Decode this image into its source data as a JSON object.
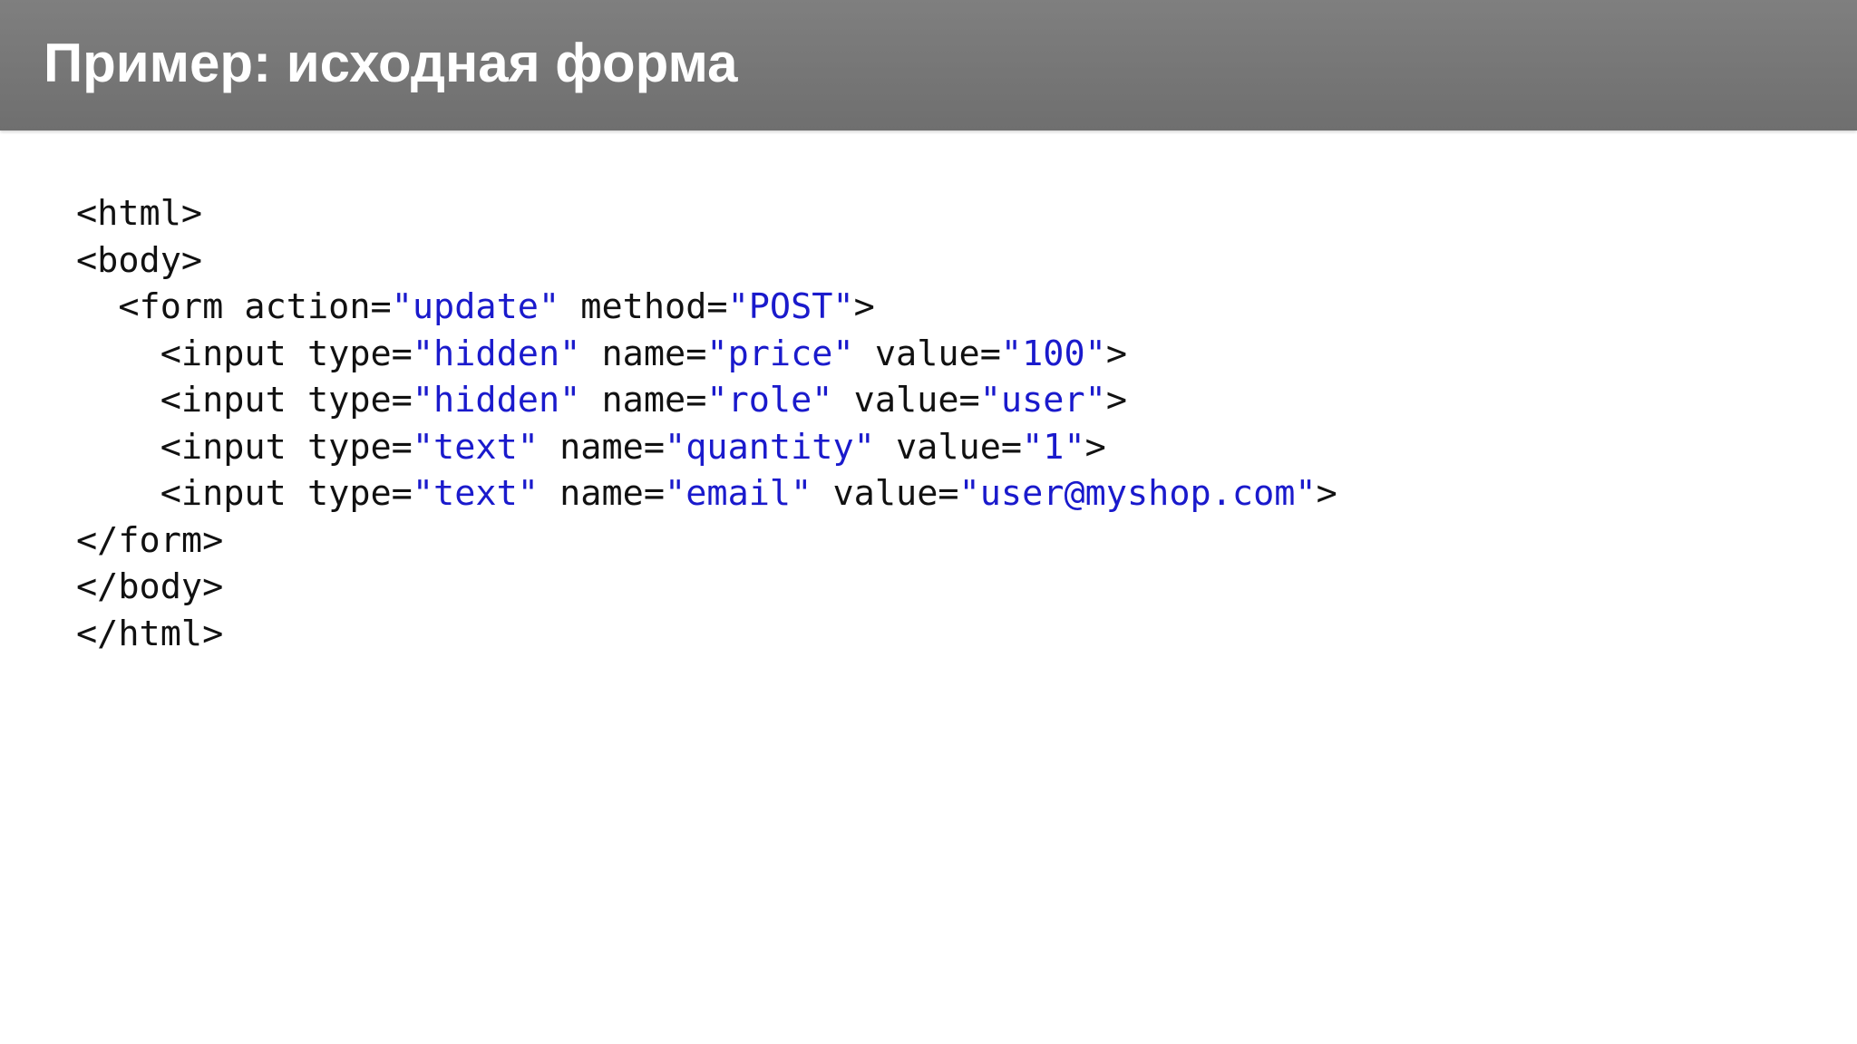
{
  "slide": {
    "title": "Пример: исходная форма"
  },
  "code": {
    "lines": [
      {
        "indent": 0,
        "tokens": [
          {
            "t": "<html>",
            "k": "plain"
          }
        ]
      },
      {
        "indent": 0,
        "tokens": [
          {
            "t": "<body>",
            "k": "plain"
          }
        ]
      },
      {
        "indent": 2,
        "tokens": [
          {
            "t": "<form action=",
            "k": "plain"
          },
          {
            "t": "\"update\"",
            "k": "str"
          },
          {
            "t": " method=",
            "k": "plain"
          },
          {
            "t": "\"POST\"",
            "k": "str"
          },
          {
            "t": ">",
            "k": "plain"
          }
        ]
      },
      {
        "indent": 4,
        "tokens": [
          {
            "t": "<input type=",
            "k": "plain"
          },
          {
            "t": "\"hidden\"",
            "k": "str"
          },
          {
            "t": " name=",
            "k": "plain"
          },
          {
            "t": "\"price\"",
            "k": "str"
          },
          {
            "t": " value=",
            "k": "plain"
          },
          {
            "t": "\"100\"",
            "k": "str"
          },
          {
            "t": ">",
            "k": "plain"
          }
        ]
      },
      {
        "indent": 4,
        "tokens": [
          {
            "t": "<input type=",
            "k": "plain"
          },
          {
            "t": "\"hidden\"",
            "k": "str"
          },
          {
            "t": " name=",
            "k": "plain"
          },
          {
            "t": "\"role\"",
            "k": "str"
          },
          {
            "t": " value=",
            "k": "plain"
          },
          {
            "t": "\"user\"",
            "k": "str"
          },
          {
            "t": ">",
            "k": "plain"
          }
        ]
      },
      {
        "indent": 4,
        "tokens": [
          {
            "t": "<input type=",
            "k": "plain"
          },
          {
            "t": "\"text\"",
            "k": "str"
          },
          {
            "t": " name=",
            "k": "plain"
          },
          {
            "t": "\"quantity\"",
            "k": "str"
          },
          {
            "t": " value=",
            "k": "plain"
          },
          {
            "t": "\"1\"",
            "k": "str"
          },
          {
            "t": ">",
            "k": "plain"
          }
        ]
      },
      {
        "indent": 4,
        "tokens": [
          {
            "t": "<input type=",
            "k": "plain"
          },
          {
            "t": "\"text\"",
            "k": "str"
          },
          {
            "t": " name=",
            "k": "plain"
          },
          {
            "t": "\"email\"",
            "k": "str"
          },
          {
            "t": " value=",
            "k": "plain"
          },
          {
            "t": "\"user@myshop.com\"",
            "k": "str"
          },
          {
            "t": ">",
            "k": "plain"
          }
        ]
      },
      {
        "indent": 0,
        "tokens": [
          {
            "t": "</form>",
            "k": "plain"
          }
        ]
      },
      {
        "indent": 0,
        "tokens": [
          {
            "t": "</body>",
            "k": "plain"
          }
        ]
      },
      {
        "indent": 0,
        "tokens": [
          {
            "t": "</html>",
            "k": "plain"
          }
        ]
      }
    ]
  },
  "colors": {
    "title_bar": "#777777",
    "title_text": "#ffffff",
    "code_text": "#111111",
    "code_string": "#1a1acc",
    "background": "#ffffff"
  }
}
